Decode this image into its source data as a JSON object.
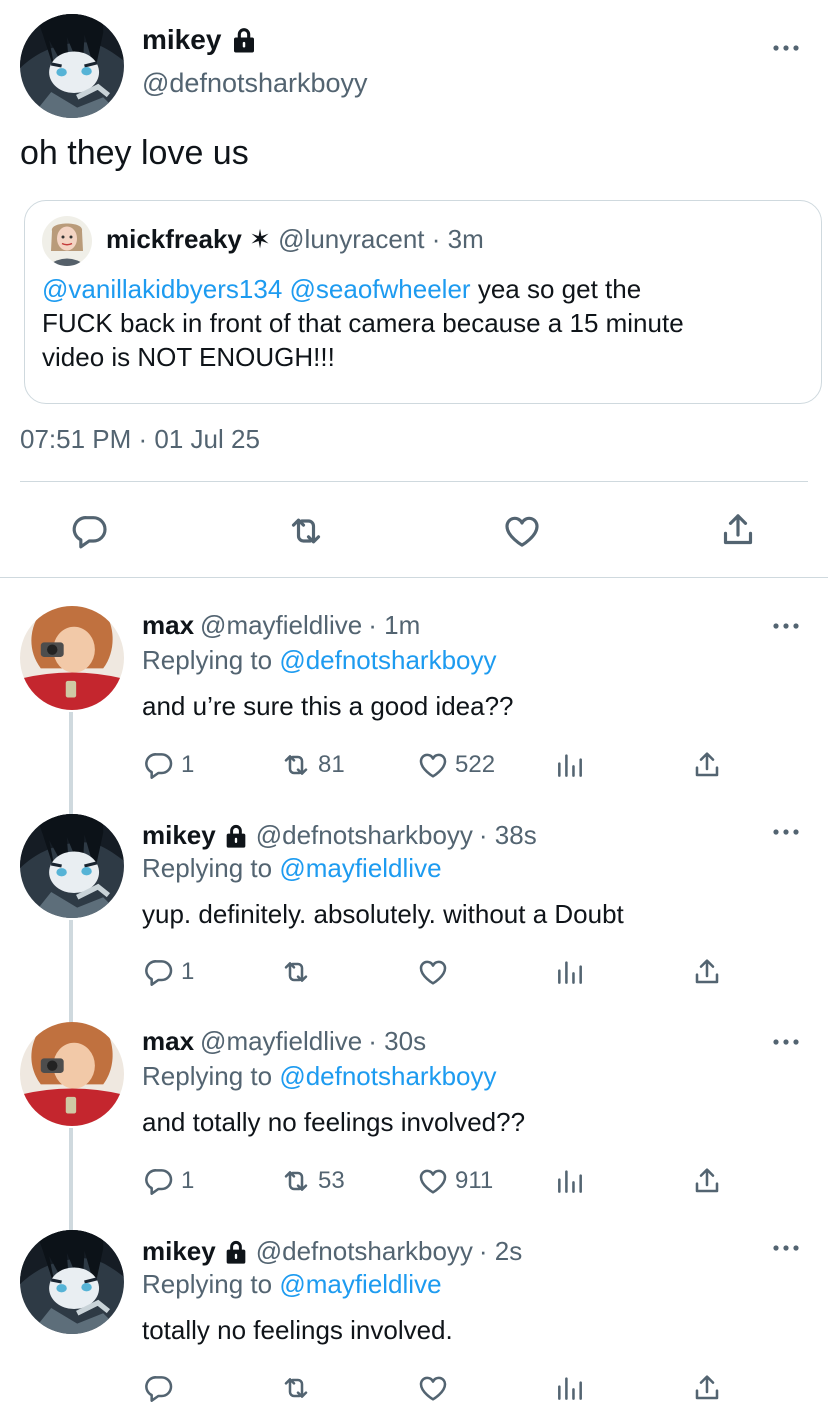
{
  "main_tweet": {
    "name": "mikey",
    "handle": "@defnotsharkboyy",
    "text": "oh they love us",
    "quote": {
      "name": "mickfreaky",
      "name_suffix": "✶",
      "handle": "@lunyracent",
      "time": "· 3m",
      "mention1": "@vanillakidbyers134",
      "mention2": "@seaofwheeler",
      "line1_rest": " yea so get the",
      "line2": "FUCK back in front of that camera because a 15 minute",
      "line3": "video is NOT ENOUGH!!!"
    },
    "timestamp": "07:51 PM · 01 Jul 25"
  },
  "replies": [
    {
      "name": "max",
      "handle": "@mayfieldlive",
      "time": "· 1m",
      "replying_prefix": "Replying to",
      "replying_to": "@defnotsharkboyy",
      "text": "and u’re sure this a good idea??",
      "replies": "1",
      "retweets": "81",
      "likes": "522"
    },
    {
      "name": "mikey",
      "handle": "@defnotsharkboyy",
      "time": "· 38s",
      "replying_prefix": "Replying to",
      "replying_to": "@mayfieldlive",
      "text": "yup. definitely. absolutely. without a Doubt",
      "replies": "1",
      "retweets": "",
      "likes": ""
    },
    {
      "name": "max",
      "handle": "@mayfieldlive",
      "time": "· 30s",
      "replying_prefix": "Replying to",
      "replying_to": "@defnotsharkboyy",
      "text": "and totally no feelings involved??",
      "replies": "1",
      "retweets": "53",
      "likes": "911"
    },
    {
      "name": "mikey",
      "handle": "@defnotsharkboyy",
      "time": "· 2s",
      "replying_prefix": "Replying to",
      "replying_to": "@mayfieldlive",
      "text": "totally no feelings involved.",
      "replies": "",
      "retweets": "",
      "likes": ""
    }
  ],
  "colors": {
    "link": "#1d9bf0",
    "secondary_text": "#536471",
    "divider": "#cfd9de"
  },
  "icons": [
    "lock-icon",
    "more-icon",
    "reply-icon",
    "retweet-icon",
    "like-icon",
    "share-icon",
    "views-icon"
  ]
}
